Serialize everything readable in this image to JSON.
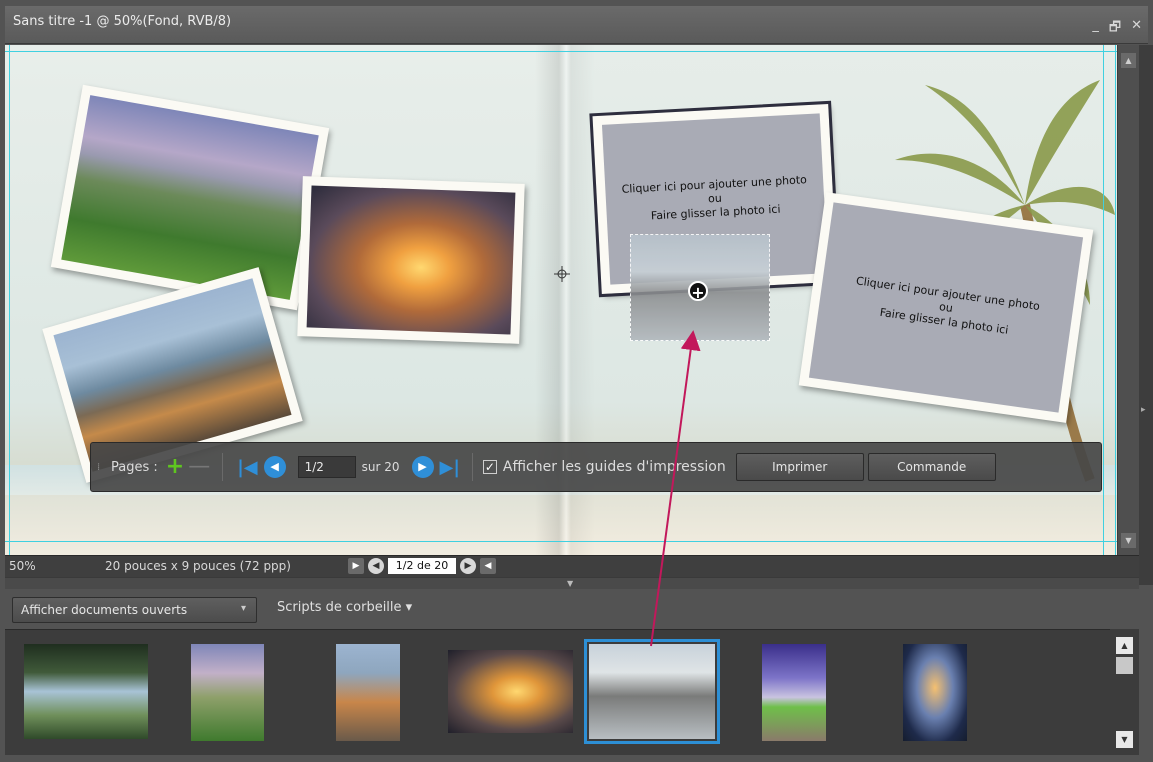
{
  "window": {
    "title": "Sans titre -1 @ 50%(Fond, RVB/8)",
    "minimize": "_",
    "restore": "🗗",
    "close": "✕"
  },
  "canvas": {
    "placeholder_1": {
      "line1": "Cliquer ici pour ajouter une photo",
      "line2": "ou",
      "line3": "Faire glisser la photo ici"
    },
    "placeholder_2": {
      "line1": "Cliquer ici pour ajouter une photo",
      "line2": "ou",
      "line3": "Faire glisser la photo ici"
    },
    "drag_plus": "+"
  },
  "pagebar": {
    "label": "Pages :",
    "add": "+",
    "remove": "—",
    "first": "|◀",
    "prev": "◀",
    "page_value": "1/2",
    "total": "sur 20",
    "next": "▶",
    "last": "▶|",
    "check_mark": "✓",
    "show_guides": "Afficher les guides d'impression",
    "print": "Imprimer",
    "order": "Commande"
  },
  "status": {
    "zoom": "50%",
    "size": "20 pouces x 9 pouces (72 ppp)",
    "play": "▶",
    "prev": "◀",
    "page": "1/2 de 20",
    "next": "▶",
    "more": "◀"
  },
  "bin": {
    "show_docs": "Afficher documents ouverts",
    "caret": "▾",
    "scripts": "Scripts de corbeille ▾",
    "scroll_up": "▲",
    "scroll_down": "▼"
  },
  "colors": {
    "accent": "#2d8fd5",
    "add_green": "#5fc61f",
    "guide": "#3fd0e0",
    "arrow": "#c2185b"
  }
}
